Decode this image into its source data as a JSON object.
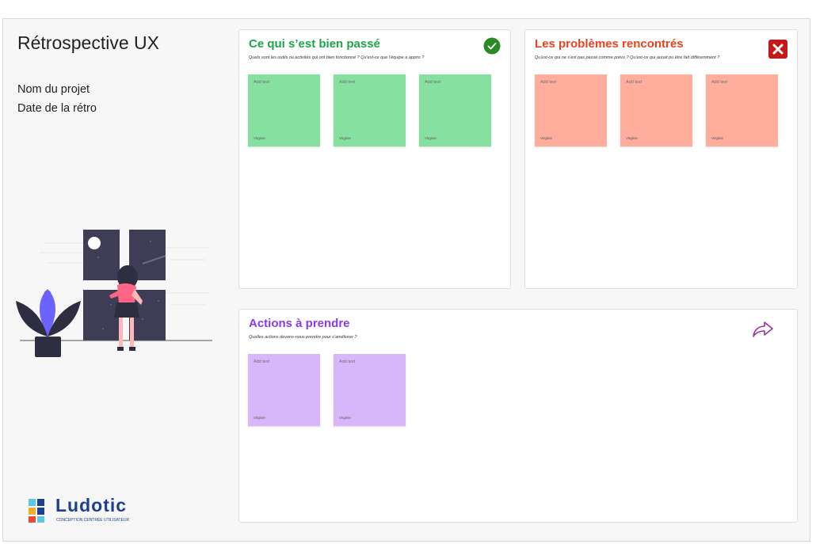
{
  "board": {
    "title": "Rétrospective UX",
    "project_label": "Nom du projet",
    "date_label": "Date de la rétro"
  },
  "panels": {
    "went_well": {
      "title": "Ce qui s’est bien passé",
      "subtitle": "Quels sont les outils ou activités qui ont bien fonctionné ? Qu'est-ce que l'équipe a appris ?",
      "icon": "check-circle-icon",
      "notes": [
        {
          "text": "Add text",
          "author": "Virginie"
        },
        {
          "text": "Add text",
          "author": "Virginie"
        },
        {
          "text": "Add text",
          "author": "Virginie"
        }
      ]
    },
    "problems": {
      "title": "Les problèmes rencontrés",
      "subtitle": "Qu'est-ce qui ne s'est pas passé comme prévu ? Qu'est-ce qui aurait pu être fait différemment ?",
      "icon": "close-box-icon",
      "notes": [
        {
          "text": "Add text",
          "author": "Virginie"
        },
        {
          "text": "Add text",
          "author": "Virginie"
        },
        {
          "text": "Add text",
          "author": "Virginie"
        }
      ]
    },
    "actions": {
      "title": "Actions à prendre",
      "subtitle": "Quelles actions devons-nous prendre pour s'améliorer ?",
      "icon": "share-arrow-icon",
      "notes": [
        {
          "text": "Add text",
          "author": "Virginie"
        },
        {
          "text": "Add text",
          "author": "Virginie"
        }
      ]
    }
  },
  "logo": {
    "name": "Ludotic",
    "tagline": "CONCEPTION CENTRÉE UTILISATEUR"
  },
  "colors": {
    "green_title": "#1fa64b",
    "red_title": "#e8431f",
    "purple_title": "#8a3be6",
    "green_note": "#86e0a0",
    "red_note": "#ffae9e",
    "purple_note": "#d8b6fa",
    "logo_blue": "#1e3f8f"
  }
}
